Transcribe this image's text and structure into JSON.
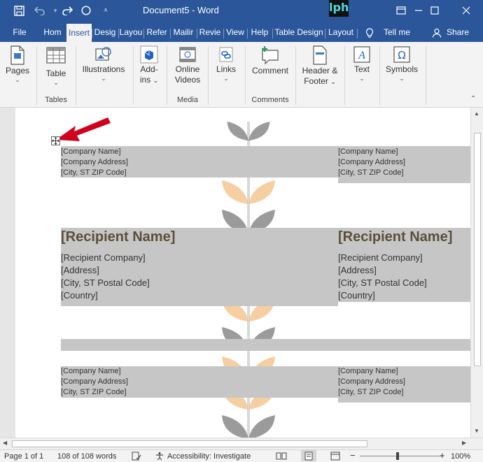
{
  "window": {
    "title": "Document5  -  Word",
    "overlay_logo": "lph"
  },
  "ribbon_tabs": [
    "File",
    "Hom",
    "Insert",
    "Desig",
    "Layou",
    "Refer",
    "Mailir",
    "Revie",
    "View",
    "Help",
    "Table Design",
    "Layout"
  ],
  "active_tab": "Insert",
  "tell_me": "Tell me",
  "share": "Share",
  "ribbon": {
    "pages": "Pages",
    "table": "Table",
    "illustrations": "Illustrations",
    "addins": [
      "Add-",
      "ins"
    ],
    "online_videos": [
      "Online",
      "Videos"
    ],
    "links": "Links",
    "comment": "Comment",
    "header_footer": [
      "Header &",
      "Footer"
    ],
    "text": "Text",
    "symbols": "Symbols",
    "groups": {
      "tables": "Tables",
      "media": "Media",
      "comments": "Comments"
    }
  },
  "document": {
    "return_address": [
      "[Company Name]",
      "[Company Address]",
      "[City, ST  ZIP Code]"
    ],
    "recipient": {
      "name": "[Recipient Name]",
      "lines": [
        "[Recipient Company]",
        "[Address]",
        "[City, ST  Postal Code]",
        "[Country]"
      ]
    }
  },
  "status": {
    "page": "Page 1 of 1",
    "words": "108 of 108 words",
    "accessibility": "Accessibility: Investigate",
    "zoom": "100%"
  },
  "colors": {
    "word_blue": "#2b579a",
    "band_gray": "#c6c6c6",
    "leaf_gray": "#7a7a7a",
    "leaf_orange": "#f2c38a",
    "arrow_red": "#d0021b"
  }
}
